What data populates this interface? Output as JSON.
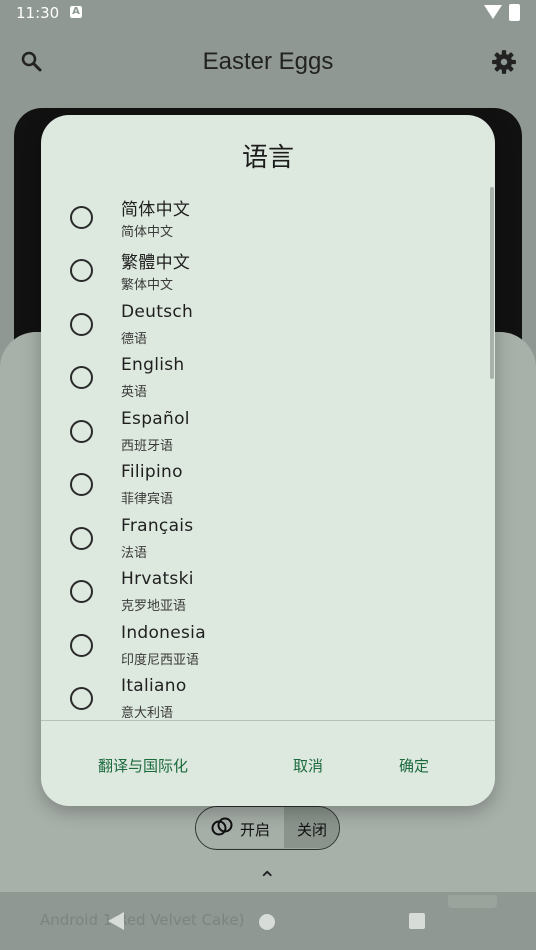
{
  "status_bar": {
    "time": "11:30",
    "notification_icon": "A"
  },
  "app_bar": {
    "title": "Easter Eggs",
    "icons": [
      "search-icon",
      "settings-icon"
    ]
  },
  "dialog": {
    "title": "语言",
    "options": [
      {
        "label": "简体中文",
        "sublabel": "简体中文",
        "selected": false
      },
      {
        "label": "繁體中文",
        "sublabel": "繁体中文",
        "selected": false
      },
      {
        "label": "Deutsch",
        "sublabel": "德语",
        "selected": false
      },
      {
        "label": "English",
        "sublabel": "英语",
        "selected": false
      },
      {
        "label": "Español",
        "sublabel": "西班牙语",
        "selected": false
      },
      {
        "label": "Filipino",
        "sublabel": "菲律宾语",
        "selected": false
      },
      {
        "label": "Français",
        "sublabel": "法语",
        "selected": false
      },
      {
        "label": "Hrvatski",
        "sublabel": "克罗地亚语",
        "selected": false
      },
      {
        "label": "Indonesia",
        "sublabel": "印度尼西亚语",
        "selected": false
      },
      {
        "label": "Italiano",
        "sublabel": "意大利语",
        "selected": false
      }
    ],
    "buttons": {
      "neutral": "翻译与国际化",
      "cancel": "取消",
      "confirm": "确定"
    }
  },
  "toggle": {
    "on_label": "开启",
    "off_label": "关闭"
  },
  "nav_bar": {
    "background_text": "Android 1 Red Velvet Cake)"
  },
  "colors": {
    "dialog_bg": "#dde8df",
    "accent": "#1a6a3c",
    "scrim": "#8f9892"
  }
}
